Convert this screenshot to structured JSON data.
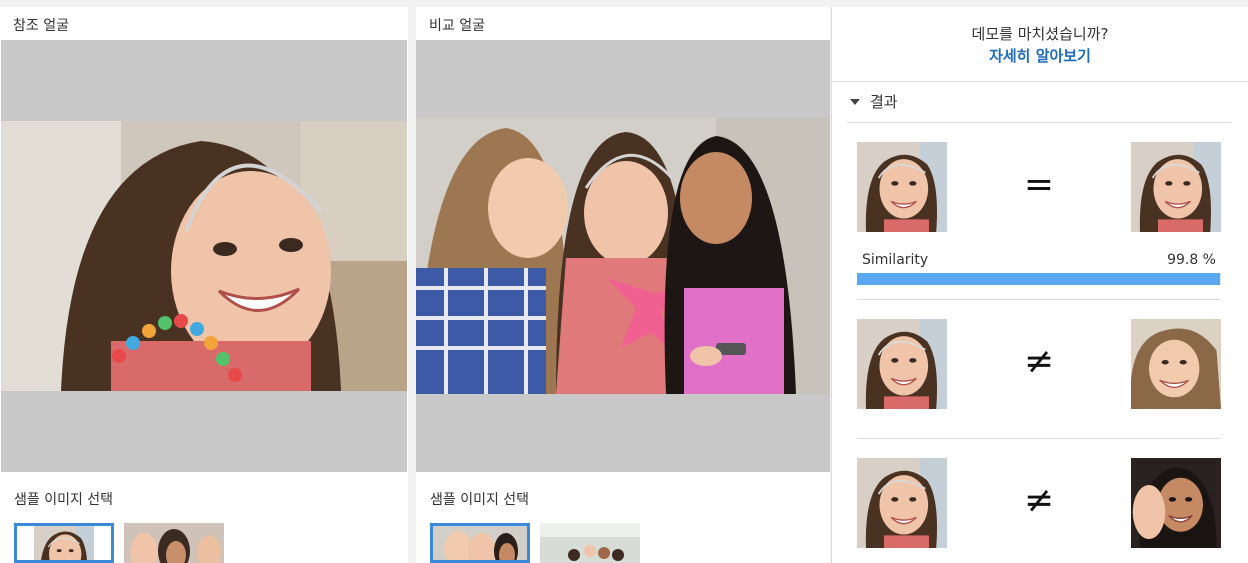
{
  "reference": {
    "title": "참조 얼굴",
    "sample_label": "샘플 이미지 선택"
  },
  "compare": {
    "title": "비교 얼굴",
    "sample_label": "샘플 이미지 선택"
  },
  "sidebar": {
    "demo_question": "데모를 마치셨습니까?",
    "learn_more": "자세히 알아보기",
    "results_label": "결과",
    "results": [
      {
        "relation": "=",
        "similarity_label": "Similarity",
        "similarity_value": "99.8 %",
        "similarity_fraction": 0.998
      },
      {
        "relation": "≠"
      },
      {
        "relation": "≠"
      }
    ]
  },
  "colors": {
    "accent": "#3b8ad9",
    "link": "#1e6bb8",
    "bar": "#5aa7ef"
  }
}
